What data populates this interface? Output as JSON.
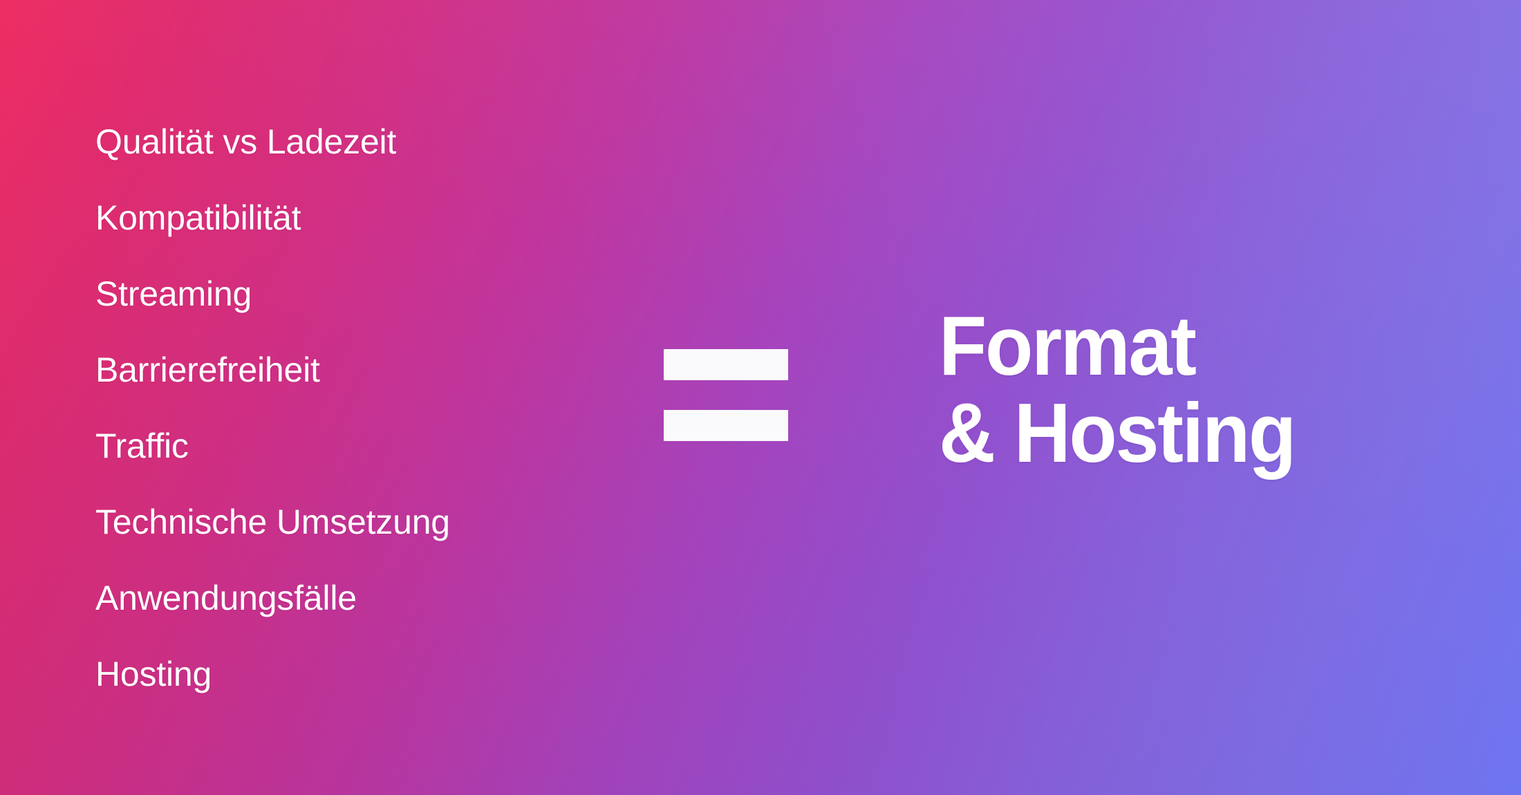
{
  "slide": {
    "background": {
      "type": "linear-gradient",
      "angle_deg": 112,
      "colors": {
        "top_left": "#ED2D63",
        "bottom_left": "#CE2E85",
        "center": "#A443C0",
        "top_right": "#877BE0",
        "bottom_right": "#6D74F0"
      }
    },
    "text_color": "#FFFFFF",
    "mark_color": "#FAFAFC"
  },
  "topic_list": {
    "items": [
      {
        "label": "Qualität vs Ladezeit"
      },
      {
        "label": "Kompatibilität"
      },
      {
        "label": "Streaming"
      },
      {
        "label": "Barrierefreiheit"
      },
      {
        "label": "Traffic"
      },
      {
        "label": "Technische Umsetzung"
      },
      {
        "label": "Anwendungsfälle"
      },
      {
        "label": "Hosting"
      }
    ]
  },
  "equals_sign": {
    "icon": "equals-icon",
    "bars": 2
  },
  "headline": {
    "line1": "Format",
    "line2": "& Hosting",
    "full": "Format & Hosting"
  }
}
